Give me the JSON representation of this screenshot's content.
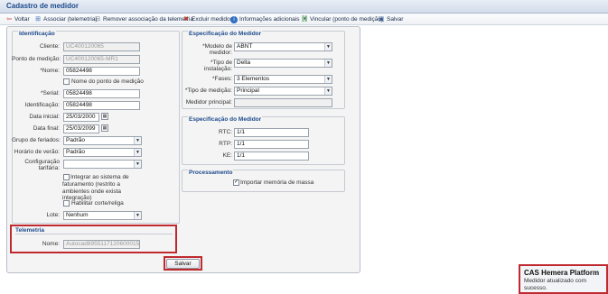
{
  "window": {
    "title": "Cadastro de medidor"
  },
  "toolbar": {
    "back": "Voltar",
    "associate": "Associar (telemetria)",
    "remove_assoc": "Remover associação da telemetria",
    "delete": "Excluir medidor",
    "info": "Informações adicionais",
    "link": "Vincular (ponto de medição)",
    "save": "Salvar"
  },
  "identificacao": {
    "legend": "Identificação",
    "cliente": {
      "label": "Cliente:",
      "value": "UC400120065"
    },
    "ponto": {
      "label": "Ponto de medição:",
      "value": "UC400120065-MR1"
    },
    "nome": {
      "label": "*Nome:",
      "value": "05824498"
    },
    "nome_ponto": "Nome do ponto de medição",
    "serial": {
      "label": "*Serial:",
      "value": "05824498"
    },
    "identificacao": {
      "label": "Identificação:",
      "value": "05824498"
    },
    "data_inicial": {
      "label": "Data inicial:",
      "value": "25/03/2000"
    },
    "data_final": {
      "label": "Data final:",
      "value": "25/03/2099"
    },
    "grupo_feriados": {
      "label": "Grupo de feriados:",
      "value": "Padrão"
    },
    "horario_verao": {
      "label": "Horário de verão:",
      "value": "Padrão"
    },
    "config_tarifaria": {
      "label": "Configuração tarifária:",
      "value": ""
    },
    "integrar": "Integrar ao sistema de faturamento (restrito a ambientes onde exista integração)",
    "habilitar": "Habilitar corte/religa",
    "lote": {
      "label": "Lote:",
      "value": "Nenhum"
    }
  },
  "telemetria": {
    "legend": "Telemetria",
    "nome": {
      "label": "Nome:",
      "value": "Autocad8955117120600015322"
    }
  },
  "espec1": {
    "legend": "Especificação do Medidor",
    "modelo": {
      "label": "*Modelo de medidor:",
      "value": "ABNT"
    },
    "tipo_instalacao": {
      "label": "*Tipo de instalação:",
      "value": "Delta"
    },
    "fases": {
      "label": "*Fases:",
      "value": "3 Elementos"
    },
    "tipo_medicao": {
      "label": "*Tipo de medição:",
      "value": "Principal"
    },
    "principal": {
      "label": "Medidor principal:",
      "value": ""
    }
  },
  "espec2": {
    "legend": "Especificação do Medidor",
    "rtc": {
      "label": "RTC:",
      "value": "1/1"
    },
    "rtp": {
      "label": "RTP:",
      "value": "1/1"
    },
    "ke": {
      "label": "KE:",
      "value": "1/1"
    }
  },
  "processamento": {
    "legend": "Processamento",
    "importar": "Importar memória de massa",
    "importar_checked": true
  },
  "footer": {
    "save": "Salvar"
  },
  "toast": {
    "title": "CAS Hemera Platform",
    "message": "Medidor atualizado com sucesso."
  }
}
